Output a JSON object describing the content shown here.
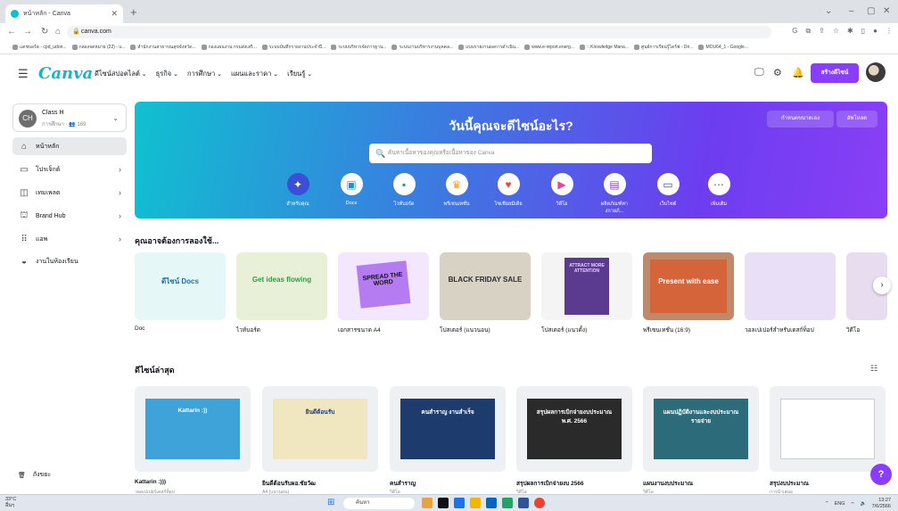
{
  "browser": {
    "tab_title": "หน้าหลัก - Canva",
    "url": "canva.com",
    "bookmarks": [
      "แดชบอร์ด - cpd_udon...",
      "กล่องจดหมาย (22) - u...",
      "สำนักงานสาธารณสุขจังหวัด...",
      "กองแผนงาน กรมส่งเสริ...",
      "ระบบบันทึกรายงานประจำปี...",
      "ระบบบริหารจัดการฐาน...",
      "ระบบงานบริหารงานบุคคล...",
      "แบบรายงานผลการดำเนิน...",
      "www.e-report.energ...",
      ":: Knowledge Mana...",
      "ศูนย์การเรียนรู้ไดร์ฟ - Dri...",
      "MOU64_1 - Google..."
    ],
    "colors": {
      "tabstrip": "#dee1e6"
    }
  },
  "header": {
    "logo": "Canva",
    "nav": [
      "ดีไซน์สปอตไลต์",
      "ธุรกิจ",
      "การศึกษา",
      "แผนและราคา",
      "เรียนรู้"
    ],
    "create_label": "สร้างดีไซน์",
    "icons": [
      "monitor-icon",
      "gear-icon",
      "bell-icon"
    ],
    "accent": "#8b3dff"
  },
  "sidebar": {
    "team_initials": "CH",
    "team_name": "Class H",
    "team_sub": "การศึกษา · 👥 169",
    "items": [
      {
        "label": "หน้าหลัก",
        "icon": "home-icon",
        "active": true
      },
      {
        "label": "โปรเจ็กต์",
        "icon": "folder-icon",
        "arrow": true
      },
      {
        "label": "เทมเพลต",
        "icon": "template-icon",
        "arrow": true
      },
      {
        "label": "Brand Hub",
        "icon": "brand-icon",
        "arrow": true
      },
      {
        "label": "แอพ",
        "icon": "apps-icon",
        "arrow": true
      },
      {
        "label": "งานในห้องเรียน",
        "icon": "classwork-icon"
      }
    ],
    "trash_label": "ถังขยะ"
  },
  "hero": {
    "title": "วันนี้คุณจะดีไซน์อะไร?",
    "custom_size": "กำหนดขนาดเอง",
    "upload": "อัพโหลด",
    "search_placeholder": "ค้นหาเนื้อหาของคุณหรือเนื้อหาของ Canva",
    "quick": [
      "สำหรับคุณ",
      "Docs",
      "ไวท์บอร์ด",
      "พรีเซนเทชั่น",
      "โซเชียลมีเดีย",
      "วิดีโอ",
      "ผลิตภัณฑ์ทางกายภ์...",
      "เว็บไซต์",
      "เพิ่มเติม"
    ]
  },
  "suggest": {
    "title": "คุณอาจต้องการลองใช้...",
    "cards": [
      {
        "caption": "Doc",
        "art": "ดีไซน์ Docs"
      },
      {
        "caption": "ไวท์บอร์ด",
        "art": "Get ideas flowing"
      },
      {
        "caption": "เอกสารขนาด A4",
        "art": "SPREAD THE WORD"
      },
      {
        "caption": "โปสเตอร์ (แนวนอน)",
        "art": "BLACK FRIDAY SALE"
      },
      {
        "caption": "โปสเตอร์ (แนวตั้ง)",
        "art": "ATTRACT MORE ATTENTION"
      },
      {
        "caption": "พรีเซนเทชั่น (16:9)",
        "art": "Present with ease"
      },
      {
        "caption": "วอลเปเปอร์สำหรับเดสก์ท็อป",
        "art": ""
      },
      {
        "caption": "วิดีโอ",
        "art": ""
      }
    ]
  },
  "recent": {
    "title": "ดีไซน์ล่าสุด",
    "items": [
      {
        "caption": "Kattarin :)))",
        "sub": "วอลเปเปอร์เดสก์ท็อป",
        "art": "Kattarin :))"
      },
      {
        "caption": "ยินดีต้อนรับผอ.ชัยวัฒ",
        "sub": "A4 (แนวนอน)",
        "art": "ยินดีต้อนรับ"
      },
      {
        "caption": "คนสำราญ",
        "sub": "วิดีโอ",
        "art": "คนสำราญ งานสำเร็จ"
      },
      {
        "caption": "สรุปผลการเบิกจ่ายงบ 2566",
        "sub": "วิดีโอ",
        "art": "สรุปผลการเบิกจ่ายงบประมาณ พ.ศ. 2566"
      },
      {
        "caption": "แผนงานงบประมาณ",
        "sub": "วิดีโอ",
        "art": "แผนปฏิบัติงานและงบประมาณรายจ่าย"
      },
      {
        "caption": "สรุปงบประมาณ",
        "sub": "การนำเสนอ",
        "art": ""
      }
    ]
  },
  "taskbar": {
    "temp": "33°C",
    "weather": "อื่นๆ",
    "search": "ค้นหา",
    "lang": "ENG",
    "time": "13:27",
    "date": "7/6/2566"
  }
}
